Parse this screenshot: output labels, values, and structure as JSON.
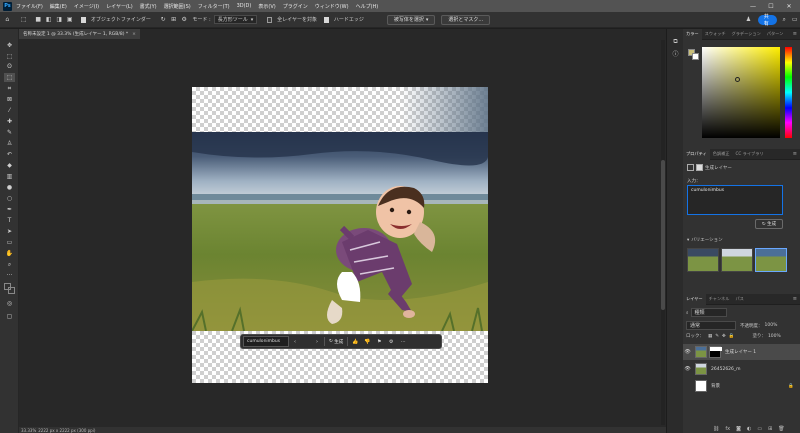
{
  "app": {
    "logo_text": "Ps"
  },
  "menubar": {
    "items": [
      "ファイル(F)",
      "編集(E)",
      "イメージ(I)",
      "レイヤー(L)",
      "書式(Y)",
      "選択範囲(S)",
      "フィルター(T)",
      "3D(D)",
      "表示(V)",
      "プラグイン",
      "ウィンドウ(W)",
      "ヘルプ(H)"
    ],
    "minimize": "—",
    "maximize": "☐",
    "close": "✕"
  },
  "optionsbar": {
    "object_finder": "オブジェクトファインダー",
    "mode_label": "モード :",
    "mode_value": "長方形ツール",
    "all_layers": "全レイヤーを対象",
    "hard_edge": "ハードエッジ",
    "select_subject": "被写体を選択",
    "select_and_mask": "選択とマスク...",
    "share": "共有"
  },
  "document": {
    "tab_title": "名称未設定 1 @ 33.3% (生成レイヤー 1, RGB/8) *",
    "tab_close": "×"
  },
  "taskbar": {
    "prompt_value": "cumulonimbus",
    "generate_label": "生成",
    "prev": "‹",
    "next": "›",
    "more": "···"
  },
  "statusbar": {
    "zoom": "33.33%",
    "doc_info": "2222 px x 2222 px (300 ppi)"
  },
  "panels": {
    "color_tabs": [
      "カラー",
      "スウォッチ",
      "グラデーション",
      "パターン"
    ],
    "properties_tabs": [
      "プロパティ",
      "色調補正",
      "CC ライブラリ"
    ],
    "properties_title": "生成レイヤー",
    "prompt_label": "入力：",
    "prompt_value": "cumulonimbus",
    "generate_button": "生成",
    "variations_label": "バリエーション",
    "layers_tabs": [
      "レイヤー",
      "チャンネル",
      "パス"
    ],
    "kind_label": "種類",
    "blend_mode": "通常",
    "opacity_label": "不透明度：",
    "opacity_value": "100%",
    "lock_label": "ロック：",
    "fill_label": "塗り：",
    "fill_value": "100%",
    "layers": [
      {
        "name": "生成レイヤー 1",
        "visible": true,
        "selected": true
      },
      {
        "name": "26452626_m",
        "visible": true,
        "selected": false
      },
      {
        "name": "背景",
        "visible": false,
        "selected": false
      }
    ]
  },
  "colors": {
    "accent": "#1473e6",
    "foreground_swatch": "#c9bf7a",
    "background_swatch": "#ffffff"
  }
}
